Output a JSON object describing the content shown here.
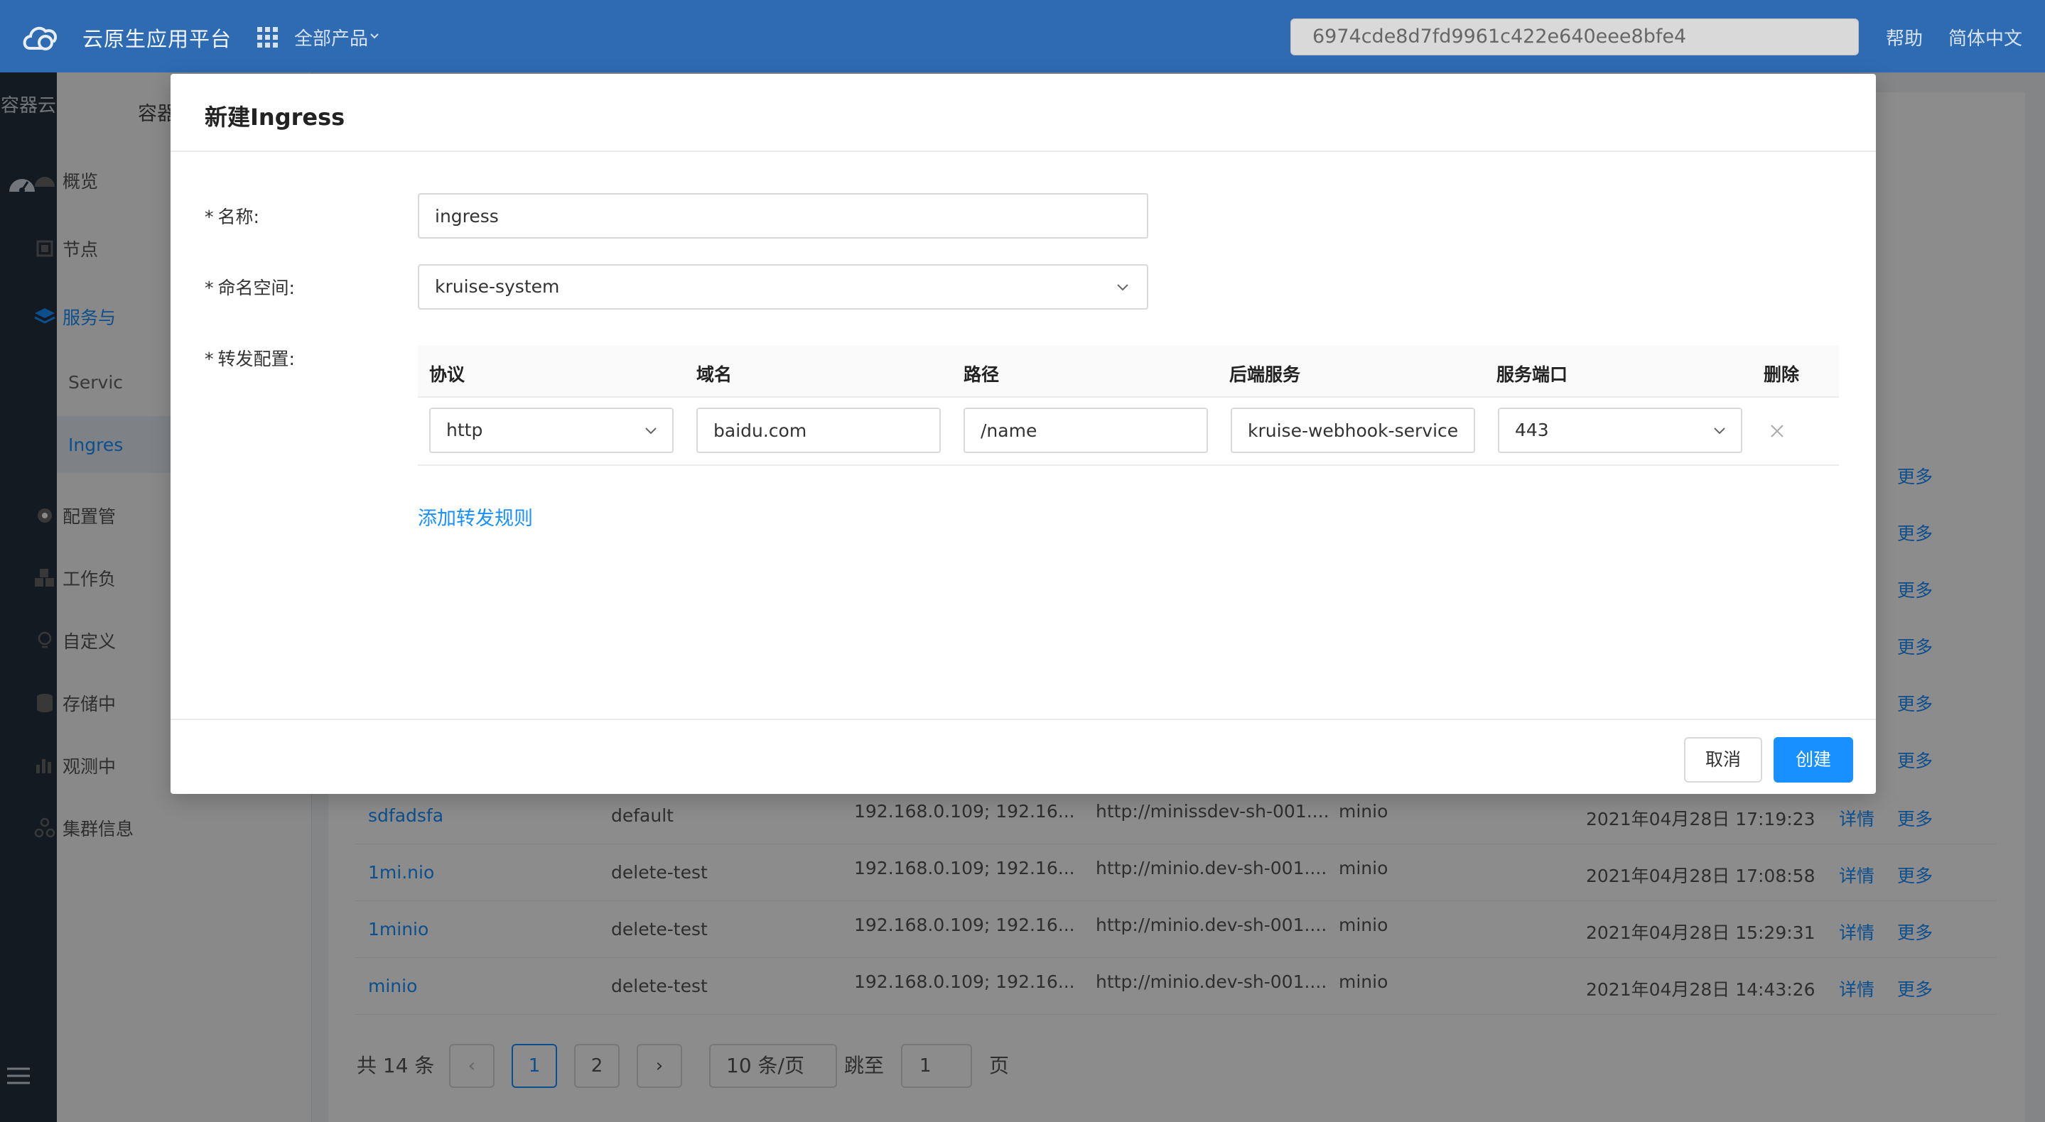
{
  "header": {
    "brand": "云原生应用平台",
    "all_products": "全部产品",
    "search_value": "6974cde8d7fd9961c422e640eee8bfe4",
    "help": "帮助",
    "language": "简体中文"
  },
  "rail": {
    "title": "容器云"
  },
  "sidebar": {
    "heading": "容器",
    "items": [
      {
        "label": "概览"
      },
      {
        "label": "节点"
      },
      {
        "label": "服务与"
      },
      {
        "label": "配置管"
      },
      {
        "label": "工作负"
      },
      {
        "label": "自定义"
      },
      {
        "label": "存储中"
      },
      {
        "label": "观测中"
      },
      {
        "label": "集群信息"
      }
    ],
    "sub_items": [
      {
        "label": "Servic"
      },
      {
        "label": "Ingres"
      }
    ]
  },
  "table": {
    "more_label": "更多",
    "detail_label": "详情",
    "rows": [
      {
        "name": "sdfadsfa",
        "namespace": "default",
        "ip": "192.168.0.109; 192.16...",
        "url": "http://minissdev-sh-001....",
        "service": "minio",
        "time": "2021年04月28日 17:19:23"
      },
      {
        "name": "1mi.nio",
        "namespace": "delete-test",
        "ip": "192.168.0.109; 192.16...",
        "url": "http://minio.dev-sh-001....",
        "service": "minio",
        "time": "2021年04月28日 17:08:58"
      },
      {
        "name": "1minio",
        "namespace": "delete-test",
        "ip": "192.168.0.109; 192.16...",
        "url": "http://minio.dev-sh-001....",
        "service": "minio",
        "time": "2021年04月28日 15:29:31"
      },
      {
        "name": "minio",
        "namespace": "delete-test",
        "ip": "192.168.0.109; 192.16...",
        "url": "http://minio.dev-sh-001....",
        "service": "minio",
        "time": "2021年04月28日 14:43:26"
      }
    ]
  },
  "pagination": {
    "total": "共 14 条",
    "prev": "‹",
    "page1": "1",
    "page2": "2",
    "next": "›",
    "page_size": "10 条/页",
    "jump_label": "跳至",
    "jump_value": "1",
    "page_suffix": "页"
  },
  "modal": {
    "title": "新建Ingress",
    "name_label": "名称:",
    "name_value": "ingress",
    "namespace_label": "命名空间:",
    "namespace_value": "kruise-system",
    "forward_label": "转发配置:",
    "columns": {
      "protocol": "协议",
      "domain": "域名",
      "path": "路径",
      "backend": "后端服务",
      "port": "服务端口",
      "delete": "删除"
    },
    "rule": {
      "protocol": "http",
      "domain": "baidu.com",
      "path": "/name",
      "backend": "kruise-webhook-service",
      "port": "443"
    },
    "add_rule": "添加转发规则",
    "cancel": "取消",
    "create": "创建"
  },
  "colors": {
    "header_bg": "#2e6bb3",
    "rail_bg": "#23303f",
    "primary": "#1890ff"
  }
}
